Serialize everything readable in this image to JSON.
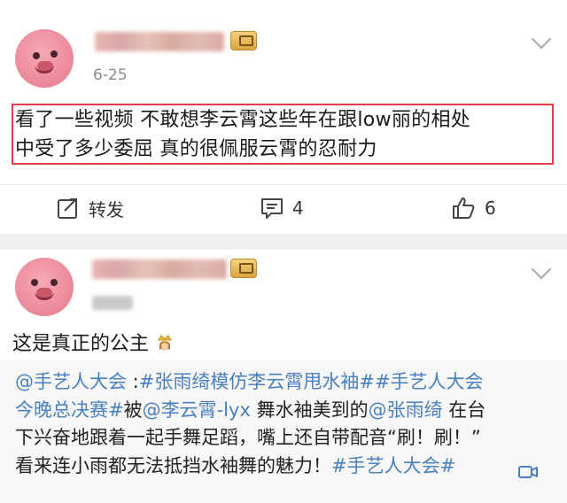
{
  "post1": {
    "date": "6-25",
    "text_line1": "看了一些视频 不敢想李云霄这些年在跟low丽的相处",
    "text_line2": "中受了多少委屈 真的很佩服云霄的忍耐力",
    "actions": {
      "repost_label": "转发",
      "comment_count": "4",
      "like_count": "6"
    }
  },
  "post2": {
    "text": "这是真正的公主",
    "repost": {
      "line1": [
        {
          "text": "@手艺人大会",
          "type": "link"
        },
        {
          "text": " :",
          "type": "plain"
        },
        {
          "text": "#张雨绮模仿李云霄甩水袖##手艺人大会",
          "type": "link"
        }
      ],
      "line2": [
        {
          "text": "今晚总决赛#",
          "type": "link"
        },
        {
          "text": "被",
          "type": "plain"
        },
        {
          "text": "@李云霄-lyx",
          "type": "link"
        },
        {
          "text": " 舞水袖美到的",
          "type": "plain"
        },
        {
          "text": "@张雨绮",
          "type": "link"
        },
        {
          "text": " 在台",
          "type": "plain"
        }
      ],
      "line3": [
        {
          "text": "下兴奋地跟着一起手舞足蹈，嘴上还自带配音“刷！刷！”",
          "type": "plain"
        }
      ],
      "line4": [
        {
          "text": "看来连小雨都无法抵挡水袖舞的魅力！",
          "type": "plain"
        },
        {
          "text": "#手艺人大会#",
          "type": "link"
        }
      ]
    }
  },
  "colors": {
    "link": "#4a7fc1",
    "highlight_border": "#e2404a",
    "separator": "#f0f0f0",
    "repost_bg": "#f7f7f7"
  },
  "icons": [
    "avatar",
    "vip-badge-icon",
    "chevron-down-icon",
    "repost-icon",
    "comment-icon",
    "like-icon",
    "crown-emoji-icon",
    "video-icon"
  ]
}
